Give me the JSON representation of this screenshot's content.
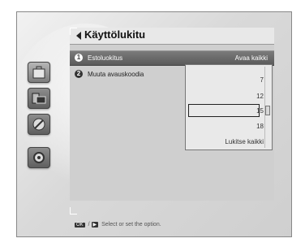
{
  "header": {
    "title": "Käyttölukitu"
  },
  "menu": {
    "items": [
      {
        "number": "1",
        "label": "Estoluokitus",
        "value": "Avaa kaikki",
        "selected": true
      },
      {
        "number": "2",
        "label": "Muuta avauskoodia",
        "selected": false
      }
    ]
  },
  "dropdown": {
    "options": [
      "7",
      "12",
      "15",
      "18",
      "Lukitse kaikki"
    ],
    "highlighted_index": 2
  },
  "help": {
    "key1": "OK",
    "separator": "/",
    "key2": "▶",
    "text": "Select or set the option."
  },
  "sidebar": {
    "icons": [
      "toolbox-icon",
      "monitor-icon",
      "satellite-dish-icon",
      "gear-icon"
    ],
    "active_index": 0
  }
}
